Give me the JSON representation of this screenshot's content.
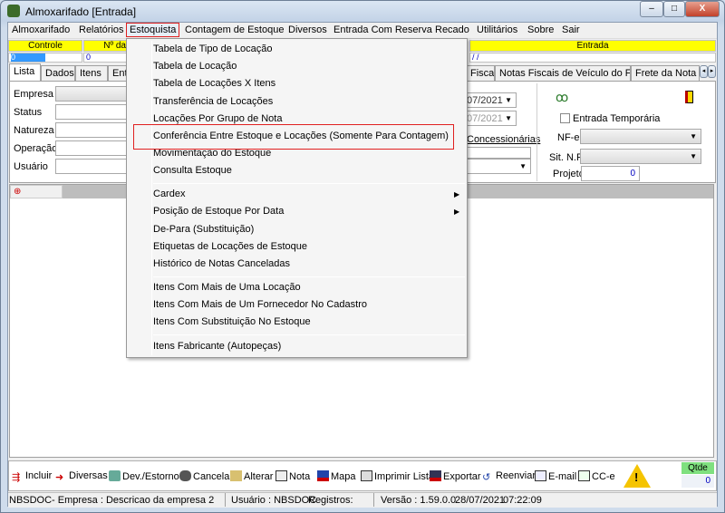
{
  "window": {
    "title": "Almoxarifado [Entrada]",
    "minimize": "–",
    "maximize": "□",
    "close": "X"
  },
  "menubar": [
    "Almoxarifado",
    "Relatórios",
    "Estoquista",
    "Contagem de Estoque",
    "Diversos",
    "Entrada Com Reserva",
    "Recado",
    "Utilitários",
    "Sobre",
    "Sair"
  ],
  "header": {
    "controle_label": "Controle",
    "numero_label": "Nº da",
    "entrada_label": "Entrada",
    "controle_value": "0",
    "numero_value": "0",
    "entrada_value": " / /"
  },
  "tabs": [
    "Lista",
    "Dados",
    "Itens",
    "Ent",
    "Fiscal",
    "Notas Fiscais de Veículo do Frete",
    "Frete da Nota F"
  ],
  "filters": {
    "empresa": "Empresa",
    "status": "Status",
    "natureza": "Natureza",
    "operacao": "Operação",
    "usuario": "Usuário",
    "date1": "07/2021",
    "date2": "07/2021",
    "concessionarias": "Concessionárias"
  },
  "right_panel": {
    "entrada_temporaria": "Entrada Temporária",
    "entrada_temporaria_checked": false,
    "nfe": "NF-e",
    "sit_nf": "Sit. N.F.",
    "projeto": "Projeto",
    "projeto_value": "0"
  },
  "estoquista_menu": [
    {
      "label": "Tabela de Tipo de Locação"
    },
    {
      "label": "Tabela de Locação"
    },
    {
      "label": "Tabela de Locações X Itens"
    },
    {
      "label": "Transferência de Locações"
    },
    {
      "label": "Locações Por Grupo de Nota"
    },
    {
      "label": "Conferência Entre Estoque e Locações (Somente Para Contagem)",
      "highlighted": true
    },
    {
      "label": "Movimentação do Estoque"
    },
    {
      "label": "Consulta Estoque"
    },
    {
      "label": "Cardex",
      "submenu": true
    },
    {
      "label": "Posição de Estoque Por Data",
      "submenu": true
    },
    {
      "label": "De-Para (Substituição)"
    },
    {
      "label": "Etiquetas de Locações de Estoque"
    },
    {
      "label": "Histórico de Notas Canceladas"
    },
    {
      "label": "Itens Com Mais de Uma Locação"
    },
    {
      "label": "Itens Com Mais de Um Fornecedor No Cadastro"
    },
    {
      "label": "Itens Com Substituição No Estoque"
    },
    {
      "label": "Itens Fabricante (Autopeças)"
    }
  ],
  "toolbar": [
    "Incluir",
    "Diversas",
    "Dev./Estorno",
    "Cancelar",
    "Alterar",
    "Nota",
    "Mapa",
    "Imprimir Lista",
    "Exportar",
    "Reenviar",
    "E-mail",
    "CC-e"
  ],
  "qtde": {
    "label": "Qtde",
    "value": "0"
  },
  "statusbar": {
    "empresa": "NBSDOC- Empresa : Descricao da empresa 2",
    "usuario": "Usuário : NBSDOC",
    "registros": "Registros:",
    "versao": "Versão : 1.59.0.0",
    "data": "28/07/2021",
    "hora": "07:22:09"
  },
  "colors": {
    "highlight_box": "#e02020",
    "header_yellow": "#ffff00",
    "qtde_green": "#7fe07f"
  }
}
